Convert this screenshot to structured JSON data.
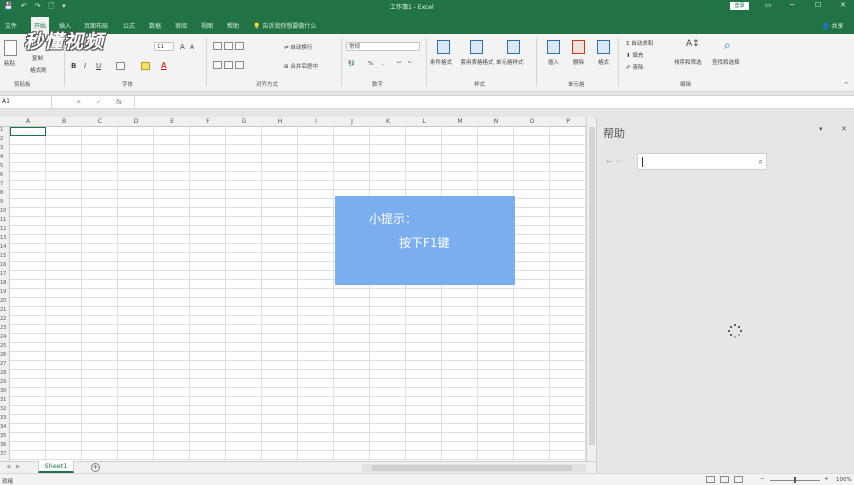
{
  "window": {
    "title": "工作簿1 - Excel",
    "signin_label": "登录",
    "controls": {
      "display_options": "▭",
      "minimize": "─",
      "maximize": "☐",
      "close": "✕"
    }
  },
  "qat": {
    "save": "💾",
    "undo": "↶",
    "redo": "↷",
    "new": "🗋",
    "more": "▾"
  },
  "tabs": [
    "文件",
    "开始",
    "插入",
    "页面布局",
    "公式",
    "数据",
    "审阅",
    "视图",
    "帮助"
  ],
  "active_tab": "开始",
  "tell_me": "告诉我你想要做什么",
  "share": "共享",
  "watermark": "秒懂视频",
  "ribbon": {
    "clipboard": {
      "paste": "粘贴",
      "cut": "剪切",
      "copy": "复制",
      "format_painter": "格式刷",
      "label": "剪贴板"
    },
    "font": {
      "size": "11",
      "bold": "B",
      "italic": "I",
      "underline": "U",
      "grow": "A",
      "shrink": "A",
      "label": "字体"
    },
    "alignment": {
      "wrap": "自动换行",
      "merge": "合并后居中",
      "label": "对齐方式"
    },
    "number": {
      "format": "常规",
      "percent": "%",
      "comma": ",",
      "label": "数字"
    },
    "styles": {
      "conditional": "条件格式",
      "table": "套用表格格式",
      "cell_styles": "单元格样式",
      "label": "样式"
    },
    "cells": {
      "insert": "插入",
      "delete": "删除",
      "format": "格式",
      "label": "单元格"
    },
    "editing": {
      "autosum": "自动求和",
      "fill": "填充",
      "clear": "清除",
      "sort": "排序和筛选",
      "find": "查找和选择",
      "label": "编辑"
    }
  },
  "formula_bar": {
    "name_box": "A1",
    "cancel": "✕",
    "enter": "✓",
    "fx": "fx",
    "value": ""
  },
  "grid": {
    "columns": [
      "A",
      "B",
      "C",
      "D",
      "E",
      "F",
      "G",
      "H",
      "I",
      "J",
      "K",
      "L",
      "M",
      "N",
      "O",
      "P"
    ],
    "rows": [
      "1",
      "2",
      "3",
      "4",
      "5",
      "6",
      "7",
      "8",
      "9",
      "10",
      "11",
      "12",
      "13",
      "14",
      "15",
      "16",
      "17",
      "18",
      "19",
      "20",
      "21",
      "22",
      "23",
      "24",
      "25",
      "26",
      "27",
      "28",
      "29",
      "30",
      "31",
      "32",
      "33",
      "34",
      "35",
      "36",
      "37"
    ],
    "selected_cell": "A1"
  },
  "hint": {
    "title": "小提示：",
    "body": "按下F1键"
  },
  "sheets": {
    "tabs": [
      "Sheet1"
    ],
    "add": "+"
  },
  "status": {
    "mode": "就绪",
    "zoom": "100%"
  },
  "help_pane": {
    "title": "帮助",
    "back": "← ···",
    "dropdown": "▾",
    "close": "✕",
    "search_placeholder": ""
  }
}
